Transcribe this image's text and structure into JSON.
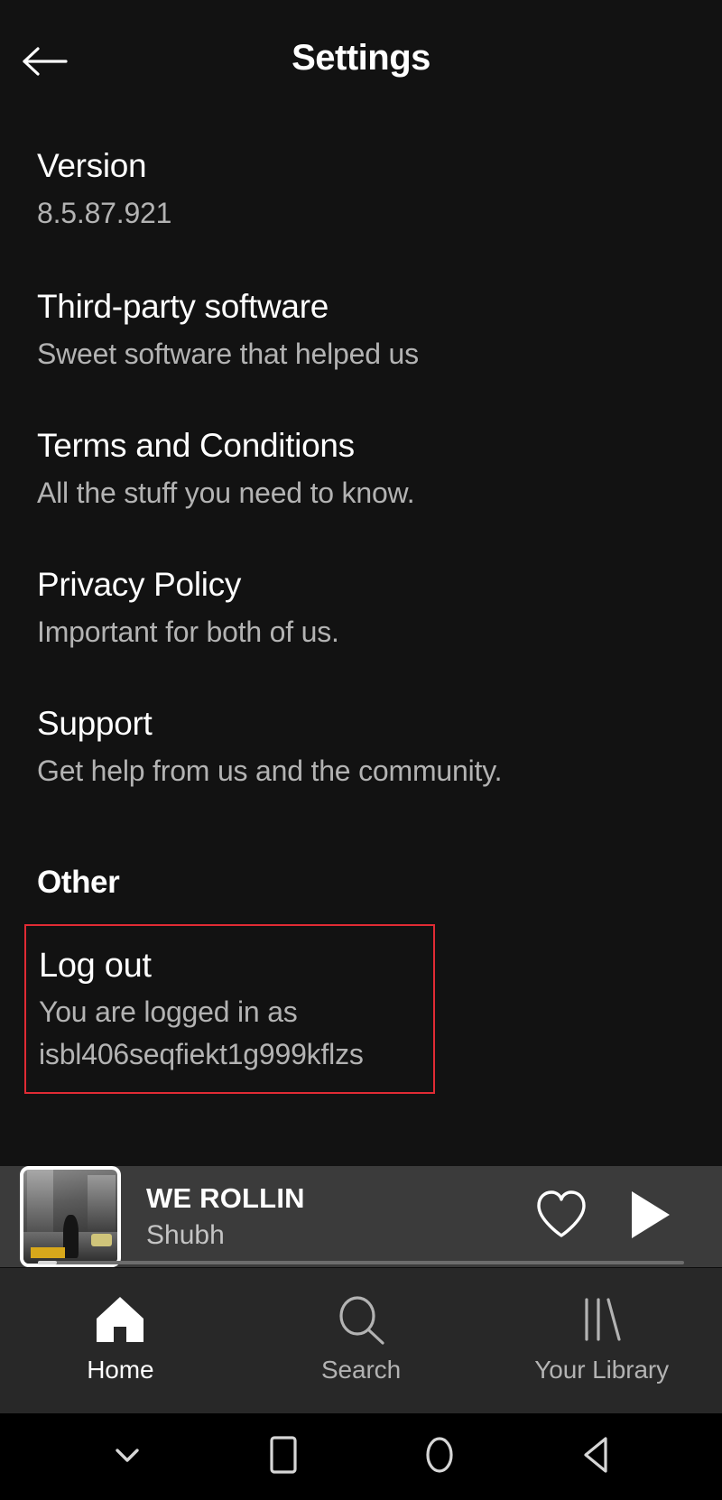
{
  "header": {
    "title": "Settings",
    "back_icon": "arrow-left-icon"
  },
  "settings": {
    "items": [
      {
        "title": "Version",
        "subtitle": "8.5.87.921"
      },
      {
        "title": "Third-party software",
        "subtitle": "Sweet software that helped us"
      },
      {
        "title": "Terms and Conditions",
        "subtitle": "All the stuff you need to know."
      },
      {
        "title": "Privacy Policy",
        "subtitle": "Important for both of us."
      },
      {
        "title": "Support",
        "subtitle": "Get help from us and the community."
      }
    ],
    "other_heading": "Other",
    "logout": {
      "title": "Log out",
      "subtitle_line1": "You are logged in as",
      "subtitle_line2": "isbl406seqfiekt1g999kflzs",
      "highlight_color": "#e02b34"
    }
  },
  "now_playing": {
    "track_title": "WE ROLLIN",
    "artist": "Shubh",
    "like_icon": "heart-outline-icon",
    "play_icon": "play-icon",
    "album_art_name": "album-art-we-rollin",
    "progress_percent": 3
  },
  "tabbar": {
    "tabs": [
      {
        "label": "Home",
        "icon": "home-icon",
        "active": true
      },
      {
        "label": "Search",
        "icon": "search-icon",
        "active": false
      },
      {
        "label": "Your Library",
        "icon": "library-icon",
        "active": false
      }
    ]
  },
  "system_nav": {
    "buttons": [
      {
        "icon": "chevron-down-icon"
      },
      {
        "icon": "square-recents-icon"
      },
      {
        "icon": "circle-home-icon"
      },
      {
        "icon": "triangle-back-icon"
      }
    ]
  },
  "colors": {
    "background": "#121212",
    "player_background": "#3b3b3b",
    "tabbar_background": "#282828",
    "primary_text": "#ffffff",
    "secondary_text": "#b3b3b3",
    "highlight": "#e02b34"
  }
}
